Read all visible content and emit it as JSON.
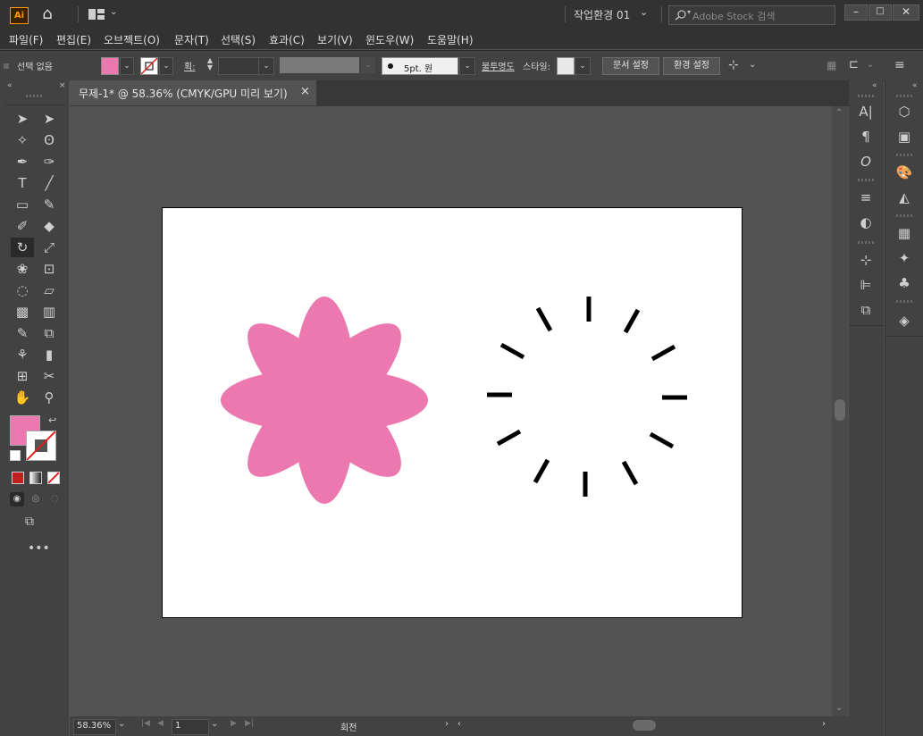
{
  "app": {
    "logo": "Ai",
    "workspace": "작업환경 01",
    "search_placeholder": "Adobe Stock 검색"
  },
  "menu": [
    "파일(F)",
    "편집(E)",
    "오브젝트(O)",
    "문자(T)",
    "선택(S)",
    "효과(C)",
    "보기(V)",
    "윈도우(W)",
    "도움말(H)"
  ],
  "control": {
    "selection_status": "선택 없음",
    "stroke_label": "획:",
    "brush": "5pt. 원",
    "opacity_label": "불투명도",
    "style_label": "스타일:",
    "doc_setup": "문서 설정",
    "preferences": "환경 설정"
  },
  "tab": {
    "title": "무제-1* @ 58.36% (CMYK/GPU 미리 보기)",
    "close": "×"
  },
  "status": {
    "zoom": "58.36%",
    "page": "1",
    "tool": "회전"
  },
  "colors": {
    "fill": "#ec78b0",
    "flower": "#ec78b0",
    "ticks": "#000000",
    "artboard": "#ffffff"
  },
  "canvas": {
    "shapes": [
      "flower",
      "sunburst-dashes"
    ]
  }
}
